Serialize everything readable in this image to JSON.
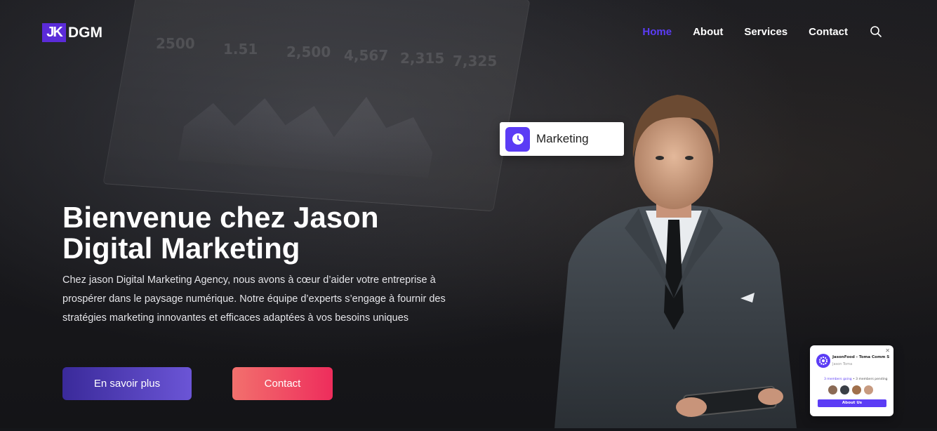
{
  "brand": {
    "mark": "JK",
    "name": "DGM"
  },
  "nav": {
    "items": [
      {
        "label": "Home",
        "active": true
      },
      {
        "label": "About",
        "active": false
      },
      {
        "label": "Services",
        "active": false
      },
      {
        "label": "Contact",
        "active": false
      }
    ],
    "search_icon": "search-icon"
  },
  "hero": {
    "title": "Bienvenue chez Jason Digital Marketing",
    "description": "Chez jason Digital Marketing Agency, nous avons à cœur d’aider votre entreprise à prospérer dans le paysage numérique. Notre équipe d’experts s’engage à fournir des stratégies marketing innovantes et efficaces adaptées à vos besoins uniques",
    "primary_button": "En savoir plus",
    "secondary_button": "Contact"
  },
  "background_stats": [
    "2500",
    "1.51",
    "2,500",
    "4,567",
    "2,315",
    "7,325"
  ],
  "badge": {
    "label": "Marketing",
    "icon": "clock-icon"
  },
  "card": {
    "name": "JasonFood - Toma Comm S",
    "sub": "Jason Toma",
    "status_prefix": "3 members going",
    "status_suffix": " • 3 members pending",
    "button": "About Us"
  },
  "colors": {
    "accent": "#5b3cf5",
    "primary_gradient": [
      "#3a2a9a",
      "#6b55d6"
    ],
    "secondary_gradient": [
      "#f2706d",
      "#ee2d5c"
    ],
    "background": "#15161a"
  }
}
